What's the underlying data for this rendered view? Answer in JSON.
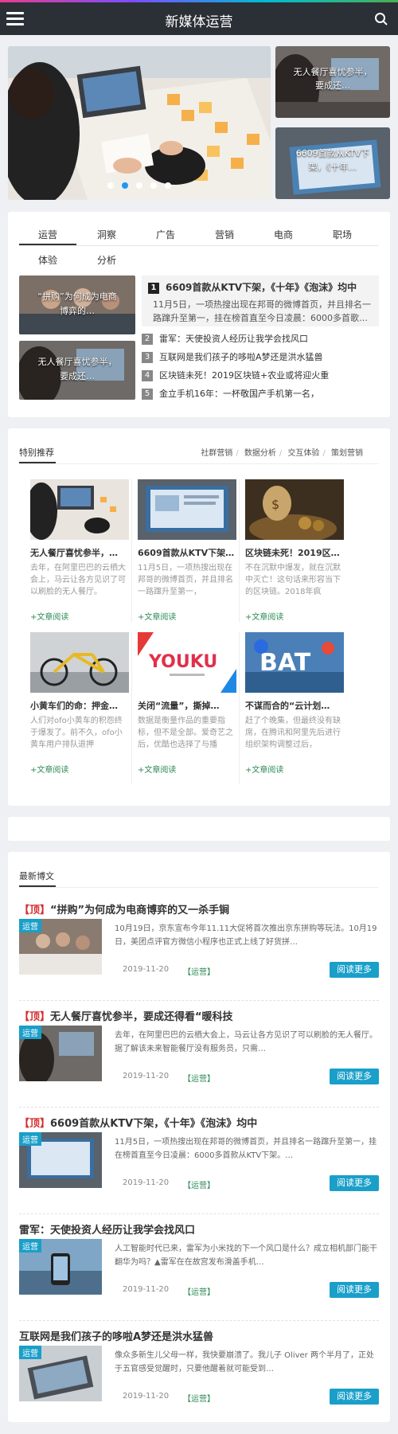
{
  "header": {
    "title": "新媒体运营"
  },
  "hero": {
    "side1_caption": "无人餐厅喜忧参半，要成还…",
    "side2_caption": "6609首款从KTV下架，《十年…"
  },
  "category": {
    "tabs": [
      "运营",
      "洞察",
      "广告",
      "营销",
      "电商",
      "职场",
      "体验",
      "分析"
    ],
    "thumb1_caption": "“拼购”为何成为电商博弈的…",
    "thumb2_caption": "无人餐厅喜忧参半，要成还…",
    "top_item": {
      "num": "1",
      "title": "6609首款从KTV下架，《十年》《泡沫》均中",
      "desc": "11月5日，一项热搜出现在邦哥的微博首页，并且排名一路蹿升至第一，挂在榜首直至今日凌晨：6000多首歌…"
    },
    "rank_items": [
      {
        "num": "2",
        "title": "雷军：天使投资人经历让我学会找风口"
      },
      {
        "num": "3",
        "title": "互联网是我们孩子的哆啦A梦还是洪水猛兽"
      },
      {
        "num": "4",
        "title": "区块链未死！2019区块链+农业或将迎火重"
      },
      {
        "num": "5",
        "title": "金立手机16年：一杯敬国产手机第一名，"
      }
    ]
  },
  "featured": {
    "heading": "特别推荐",
    "sublinks": [
      "社群营销",
      "数据分析",
      "交互体验",
      "策划营销"
    ],
    "more_label": "+文章阅读",
    "cards": [
      {
        "title": "无人餐厅喜忧参半，…",
        "summary": "去年，在阿里巴巴的云栖大会上，马云让各方见识了可以刷脸的无人餐厅。"
      },
      {
        "title": "6609首款从KTV下架…",
        "summary": "11月5日，一项热搜出现在邦哥的微博首页，并且排名一路蹿升至第一，"
      },
      {
        "title": "区块链未死！2019区…",
        "summary": "不在沉默中爆发，就在沉默中灭亡！这句话来形容当下的区块链。2018年疯"
      },
      {
        "title": "小黄车们的命：押金…",
        "summary": "人们对ofo小黄车的积怨终于爆发了。前不久，ofo小黄车用户排队退押"
      },
      {
        "title": "关闭“流量”，撕掉…",
        "summary": "数据是衡量作品的重要指标，但不是全部。爱奇艺之后，优酷也选择了与播"
      },
      {
        "title": "不谋而合的“云计划…",
        "summary": "赶了个晚集，但最终没有缺席，在腾讯和阿里先后进行组织架构调整过后，"
      }
    ]
  },
  "latest": {
    "heading": "最新博文",
    "read_more": "阅读更多",
    "posts": [
      {
        "prefix": "【顶】",
        "title": "“拼购”为何成为电商博弈的又一杀手锏",
        "badge": "运营",
        "desc": "10月19日，京东宣布今年11.11大促将首次推出京东拼购等玩法。10月19日，美团点评官方微信小程序也正式上线了好货拼…",
        "date": "2019-11-20",
        "cat": "【运营】"
      },
      {
        "prefix": "【顶】",
        "title": "无人餐厅喜忧参半，要成还得看“暖科技",
        "badge": "运营",
        "desc": "去年，在阿里巴巴的云栖大会上，马云让各方见识了可以刷脸的无人餐厅。据了解该未来智能餐厅没有服务员，只需…",
        "date": "2019-11-20",
        "cat": "【运营】"
      },
      {
        "prefix": "【顶】",
        "title": "6609首款从KTV下架，《十年》《泡沫》均中",
        "badge": "运营",
        "desc": "11月5日，一项热搜出现在邦哥的微博首页，并且排名一路蹿升至第一，挂在榜首直至今日凌晨：6000多首款从KTV下架。…",
        "date": "2019-11-20",
        "cat": "【运营】"
      },
      {
        "prefix": "",
        "title": "雷军：天使投资人经历让我学会找风口",
        "badge": "运营",
        "desc": "人工智能时代已来，雷军为小米找的下一个风口是什么？成立相机部门能干翻华为吗？▲雷军在在故宫发布滑盖手机…",
        "date": "2019-11-20",
        "cat": "【运营】"
      },
      {
        "prefix": "",
        "title": "互联网是我们孩子的哆啦A梦还是洪水猛兽",
        "badge": "运营",
        "desc": "像众多新生儿父母一样，我快要崩溃了。我儿子 Oliver 两个半月了，正处于五官感受觉醒时，只要他醒着就可能受到…",
        "date": "2019-11-20",
        "cat": "【运营】"
      }
    ]
  }
}
